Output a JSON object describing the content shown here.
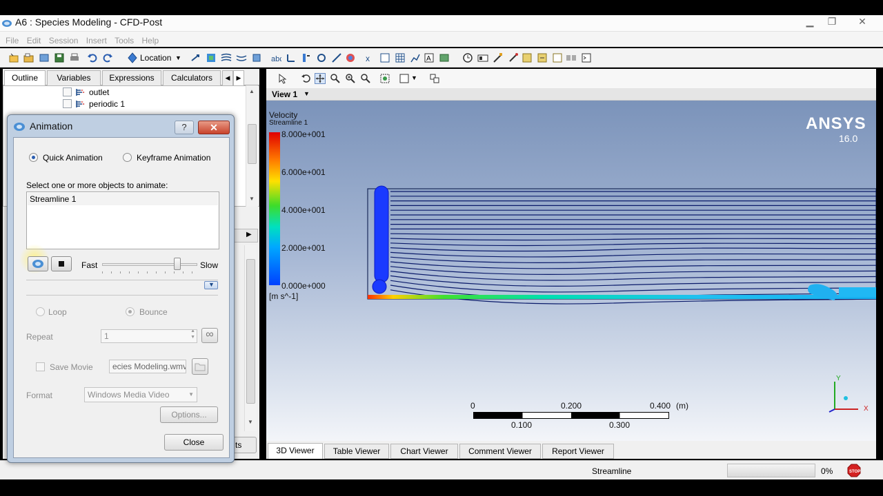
{
  "window": {
    "title": "A6 : Species Modeling - CFD-Post"
  },
  "menu": [
    "File",
    "Edit",
    "Session",
    "Insert",
    "Tools",
    "Help"
  ],
  "toolbar": {
    "location_label": "Location"
  },
  "left_tabs": [
    "Outline",
    "Variables",
    "Expressions",
    "Calculators"
  ],
  "outline_items": [
    {
      "label": "outlet"
    },
    {
      "label": "periodic 1"
    }
  ],
  "viewer": {
    "view_label": "View 1",
    "brand": "ANSYS",
    "version": "16.0",
    "legend": {
      "variable": "Velocity",
      "object": "Streamline 1",
      "ticks": [
        "8.000e+001",
        "6.000e+001",
        "4.000e+001",
        "2.000e+001",
        "0.000e+000"
      ],
      "unit": "[m s^-1]"
    },
    "scale": {
      "top_labels": [
        "0",
        "0.200",
        "0.400",
        "(m)"
      ],
      "bottom_labels": [
        "0.100",
        "0.300"
      ]
    },
    "axes": {
      "y": "Y",
      "x": "X"
    }
  },
  "bottom_tabs": [
    "3D Viewer",
    "Table Viewer",
    "Chart Viewer",
    "Comment Viewer",
    "Report Viewer"
  ],
  "status": {
    "text": "Streamline",
    "progress_label": "0%",
    "progress": 0
  },
  "dialog": {
    "title": "Animation",
    "help": "?",
    "close_x": "✕",
    "quick_animation": "Quick Animation",
    "keyframe_animation": "Keyframe Animation",
    "select_prompt": "Select one or more objects to animate:",
    "objects": [
      "Streamline 1"
    ],
    "fast": "Fast",
    "slow": "Slow",
    "loop": "Loop",
    "bounce": "Bounce",
    "repeat_label": "Repeat",
    "repeat_value": "1",
    "infinity": "∞",
    "save_movie": "Save Movie",
    "movie_file": "ecies Modeling.wmv",
    "format_label": "Format",
    "format_value": "Windows Media Video",
    "options_button": "Options...",
    "close_button": "Close"
  }
}
